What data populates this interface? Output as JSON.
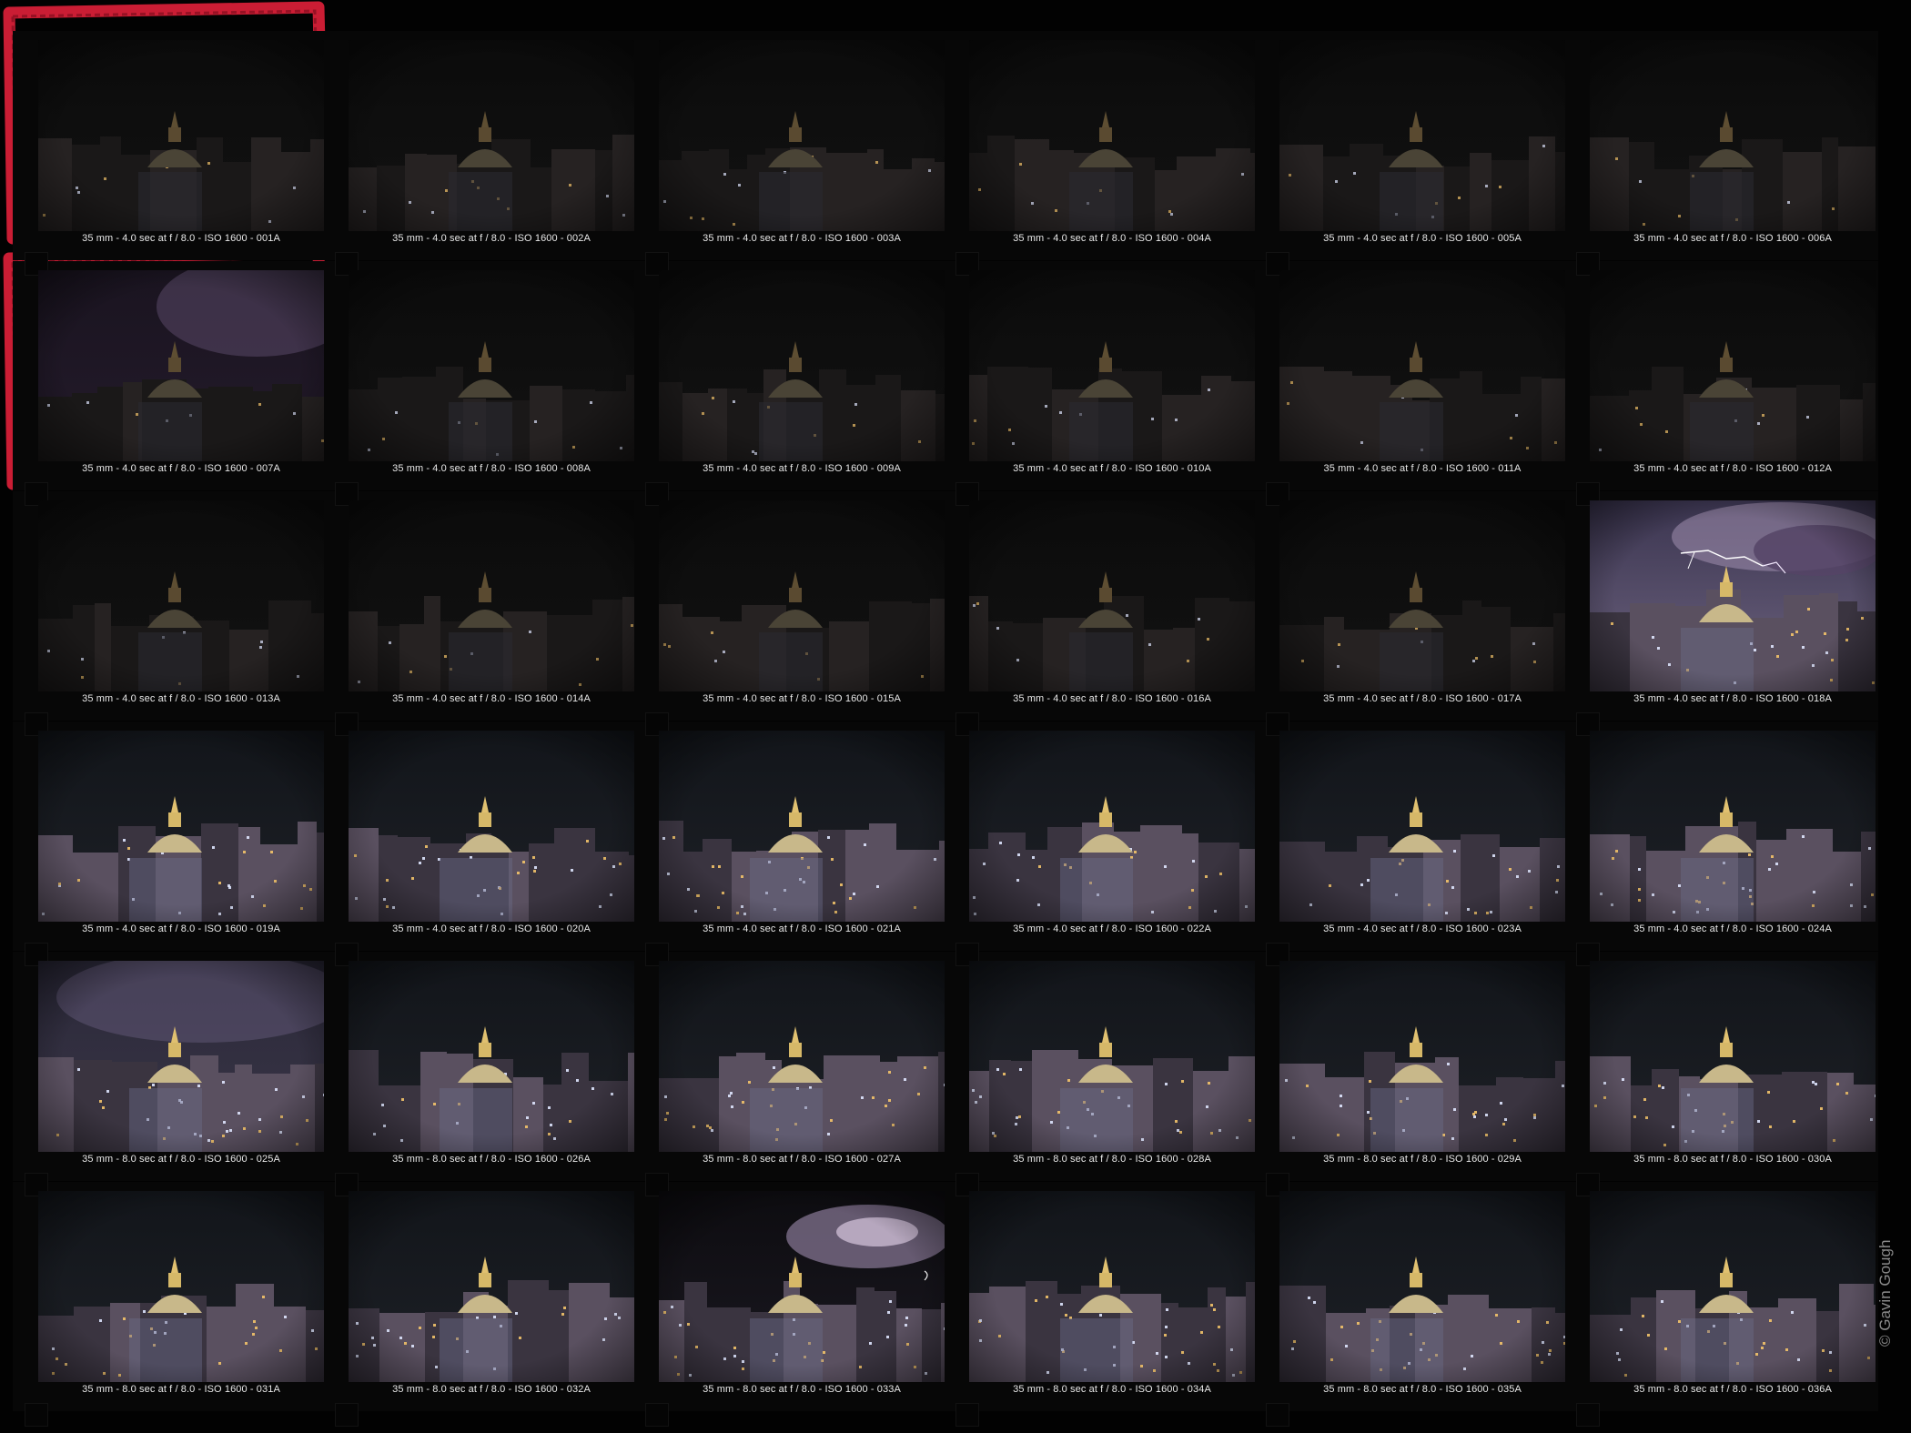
{
  "credit": "© Gavin Gough",
  "selection_color": "#e0203a",
  "frames": [
    {
      "caption": "35 mm - 4.0 sec at f / 8.0 - ISO 1600 - 001A",
      "scene": "dark",
      "selected": false
    },
    {
      "caption": "35 mm - 4.0 sec at f / 8.0 - ISO 1600 - 002A",
      "scene": "dark",
      "selected": false
    },
    {
      "caption": "35 mm - 4.0 sec at f / 8.0 - ISO 1600 - 003A",
      "scene": "dark",
      "selected": false
    },
    {
      "caption": "35 mm - 4.0 sec at f / 8.0 - ISO 1600 - 004A",
      "scene": "dark",
      "selected": false
    },
    {
      "caption": "35 mm - 4.0 sec at f / 8.0 - ISO 1600 - 005A",
      "scene": "dark",
      "selected": false
    },
    {
      "caption": "35 mm - 4.0 sec at f / 8.0 - ISO 1600 - 006A",
      "scene": "dark",
      "selected": false
    },
    {
      "caption": "35 mm - 4.0 sec at f / 8.0 - ISO 1600 - 007A",
      "scene": "dark-glow",
      "selected": false
    },
    {
      "caption": "35 mm - 4.0 sec at f / 8.0 - ISO 1600 - 008A",
      "scene": "dark",
      "selected": false
    },
    {
      "caption": "35 mm - 4.0 sec at f / 8.0 - ISO 1600 - 009A",
      "scene": "dark",
      "selected": false
    },
    {
      "caption": "35 mm - 4.0 sec at f / 8.0 - ISO 1600 - 010A",
      "scene": "dark",
      "selected": false
    },
    {
      "caption": "35 mm - 4.0 sec at f / 8.0 - ISO 1600 - 011A",
      "scene": "dark",
      "selected": false
    },
    {
      "caption": "35 mm - 4.0 sec at f / 8.0 - ISO 1600 - 012A",
      "scene": "dark",
      "selected": false
    },
    {
      "caption": "35 mm - 4.0 sec at f / 8.0 - ISO 1600 - 013A",
      "scene": "dark",
      "selected": false
    },
    {
      "caption": "35 mm - 4.0 sec at f / 8.0 - ISO 1600 - 014A",
      "scene": "dark",
      "selected": false
    },
    {
      "caption": "35 mm - 4.0 sec at f / 8.0 - ISO 1600 - 015A",
      "scene": "dark",
      "selected": false
    },
    {
      "caption": "35 mm - 4.0 sec at f / 8.0 - ISO 1600 - 016A",
      "scene": "dark",
      "selected": false
    },
    {
      "caption": "35 mm - 4.0 sec at f / 8.0 - ISO 1600 - 017A",
      "scene": "dark",
      "selected": false
    },
    {
      "caption": "35 mm - 4.0 sec at f / 8.0 - ISO 1600 - 018A",
      "scene": "lightning",
      "selected": true
    },
    {
      "caption": "35 mm - 4.0 sec at f / 8.0 - ISO 1600 - 019A",
      "scene": "lit",
      "selected": false
    },
    {
      "caption": "35 mm - 4.0 sec at f / 8.0 - ISO 1600 - 020A",
      "scene": "lit",
      "selected": false
    },
    {
      "caption": "35 mm - 4.0 sec at f / 8.0 - ISO 1600 - 021A",
      "scene": "lit",
      "selected": false
    },
    {
      "caption": "35 mm - 4.0 sec at f / 8.0 - ISO 1600 - 022A",
      "scene": "lit",
      "selected": false
    },
    {
      "caption": "35 mm - 4.0 sec at f / 8.0 - ISO 1600 - 023A",
      "scene": "lit",
      "selected": false
    },
    {
      "caption": "35 mm - 4.0 sec at f / 8.0 - ISO 1600 - 024A",
      "scene": "lit",
      "selected": false
    },
    {
      "caption": "35 mm - 8.0 sec at f / 8.0 - ISO 1600 - 025A",
      "scene": "lit-glow",
      "selected": false
    },
    {
      "caption": "35 mm - 8.0 sec at f / 8.0 - ISO 1600 - 026A",
      "scene": "lit",
      "selected": false
    },
    {
      "caption": "35 mm - 8.0 sec at f / 8.0 - ISO 1600 - 027A",
      "scene": "lit",
      "selected": false
    },
    {
      "caption": "35 mm - 8.0 sec at f / 8.0 - ISO 1600 - 028A",
      "scene": "lit",
      "selected": false
    },
    {
      "caption": "35 mm - 8.0 sec at f / 8.0 - ISO 1600 - 029A",
      "scene": "lit",
      "selected": false
    },
    {
      "caption": "35 mm - 8.0 sec at f / 8.0 - ISO 1600 - 030A",
      "scene": "lit",
      "selected": false
    },
    {
      "caption": "35 mm - 8.0 sec at f / 8.0 - ISO 1600 - 031A",
      "scene": "lit",
      "selected": false
    },
    {
      "caption": "35 mm - 8.0 sec at f / 8.0 - ISO 1600 - 032A",
      "scene": "lit",
      "selected": false
    },
    {
      "caption": "35 mm - 8.0 sec at f / 8.0 - ISO 1600 - 033A",
      "scene": "lightning-cloud",
      "selected": true
    },
    {
      "caption": "35 mm - 8.0 sec at f / 8.0 - ISO 1600 - 034A",
      "scene": "lit",
      "selected": false
    },
    {
      "caption": "35 mm - 8.0 sec at f / 8.0 - ISO 1600 - 035A",
      "scene": "lit",
      "selected": false
    },
    {
      "caption": "35 mm - 8.0 sec at f / 8.0 - ISO 1600 - 036A",
      "scene": "lit",
      "selected": false
    }
  ]
}
